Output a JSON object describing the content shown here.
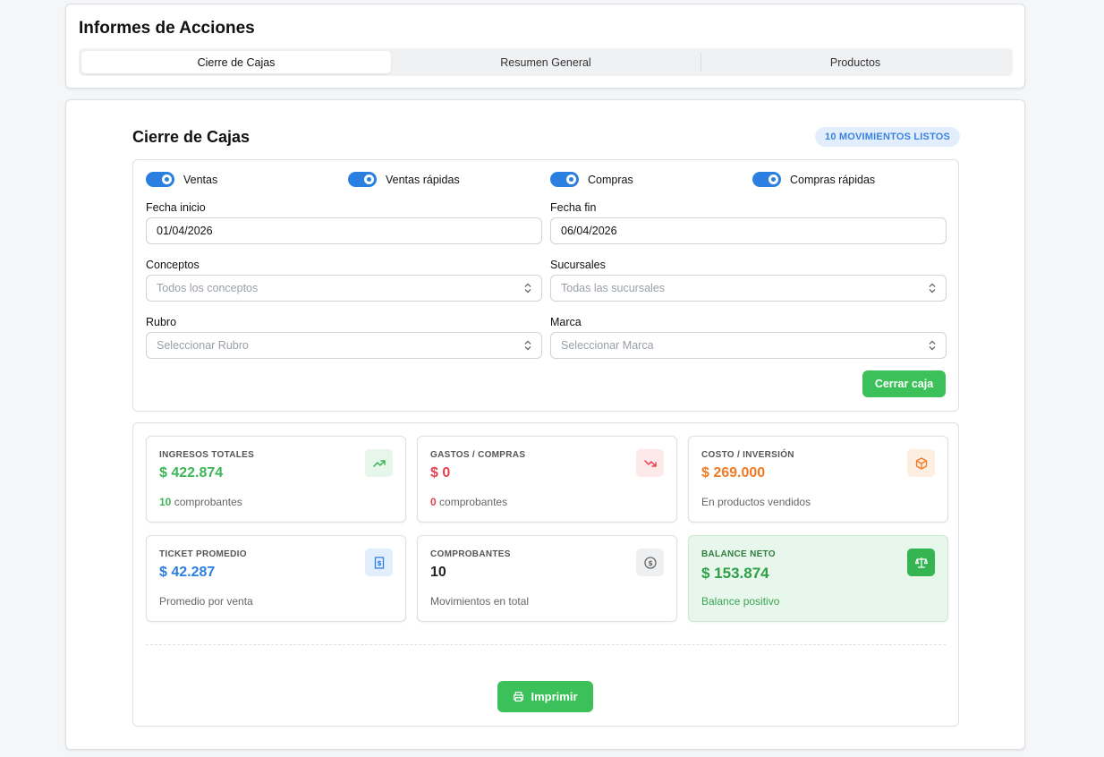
{
  "header": {
    "title": "Informes de Acciones",
    "tabs": [
      "Cierre de Cajas",
      "Resumen General",
      "Productos"
    ],
    "active_tab": "Cierre de Cajas"
  },
  "main": {
    "title": "Cierre de Cajas",
    "badge": "10 MOVIMIENTOS LISTOS",
    "toggles": [
      {
        "label": "Ventas",
        "on": true
      },
      {
        "label": "Ventas rápidas",
        "on": true
      },
      {
        "label": "Compras",
        "on": true
      },
      {
        "label": "Compras rápidas",
        "on": true
      }
    ],
    "fecha_inicio": {
      "label": "Fecha inicio",
      "value": "01/04/2026"
    },
    "fecha_fin": {
      "label": "Fecha fin",
      "value": "06/04/2026"
    },
    "conceptos": {
      "label": "Conceptos",
      "placeholder": "Todos los conceptos"
    },
    "sucursales": {
      "label": "Sucursales",
      "placeholder": "Todas las sucursales"
    },
    "rubro": {
      "label": "Rubro",
      "placeholder": "Seleccionar Rubro"
    },
    "marca": {
      "label": "Marca",
      "placeholder": "Seleccionar Marca"
    },
    "close_button": "Cerrar caja",
    "print_button": "Imprimir"
  },
  "stats": {
    "ingresos": {
      "label": "INGRESOS TOTALES",
      "value": "$ 422.874",
      "count": "10",
      "sub": "comprobantes",
      "color": "#3cb556",
      "icon": "trending-up-icon"
    },
    "gastos": {
      "label": "GASTOS / COMPRAS",
      "value": "$ 0",
      "count": "0",
      "sub": "comprobantes",
      "color": "#e5414f",
      "icon": "trending-down-icon"
    },
    "costo": {
      "label": "COSTO / INVERSIÓN",
      "value": "$ 269.000",
      "sub": "En productos vendidos",
      "color": "#f07a24",
      "icon": "package-icon"
    },
    "ticket": {
      "label": "TICKET PROMEDIO",
      "value": "$ 42.287",
      "sub": "Promedio por venta",
      "color": "#2a7fe0",
      "icon": "receipt-icon"
    },
    "comprobantes": {
      "label": "COMPROBANTES",
      "value": "10",
      "sub": "Movimientos en total",
      "color": "#222222",
      "icon": "coin-icon"
    },
    "balance": {
      "label": "BALANCE NETO",
      "value": "$ 153.874",
      "sub": "Balance positivo",
      "color": "#2e9e47",
      "icon": "scale-icon"
    }
  },
  "colors": {
    "accent_blue": "#2a7fe0",
    "accent_green": "#3cc15a"
  }
}
